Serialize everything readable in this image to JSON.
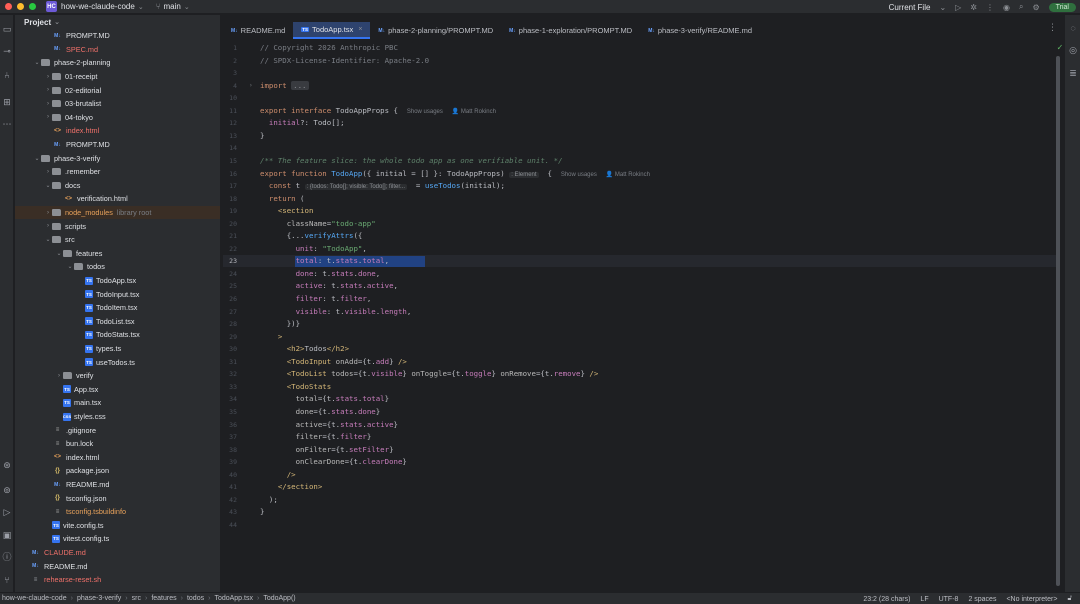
{
  "titlebar": {
    "badge": "HC",
    "project": "how-we-claude-code",
    "branch": "main",
    "run_config": "Current File",
    "trial": "Trial"
  },
  "project_panel": {
    "title": "Project",
    "rows": [
      {
        "name": "PROMPT.MD",
        "type": "md",
        "depth": 3,
        "arrow": ""
      },
      {
        "name": "SPEC.md",
        "type": "md",
        "depth": 3,
        "arrow": "",
        "color": "red"
      },
      {
        "name": "phase-2-planning",
        "type": "folder",
        "depth": 2,
        "arrow": "⌄"
      },
      {
        "name": "01-receipt",
        "type": "folder",
        "depth": 3,
        "arrow": "›"
      },
      {
        "name": "02-editorial",
        "type": "folder",
        "depth": 3,
        "arrow": "›"
      },
      {
        "name": "03-brutalist",
        "type": "folder",
        "depth": 3,
        "arrow": "›"
      },
      {
        "name": "04-tokyo",
        "type": "folder",
        "depth": 3,
        "arrow": "›"
      },
      {
        "name": "index.html",
        "type": "html",
        "depth": 3,
        "arrow": "",
        "color": "red"
      },
      {
        "name": "PROMPT.MD",
        "type": "md",
        "depth": 3,
        "arrow": ""
      },
      {
        "name": "phase-3-verify",
        "type": "folder",
        "depth": 2,
        "arrow": "⌄"
      },
      {
        "name": ".remember",
        "type": "folder",
        "depth": 3,
        "arrow": "›"
      },
      {
        "name": "docs",
        "type": "folder",
        "depth": 3,
        "arrow": "⌄"
      },
      {
        "name": "verification.html",
        "type": "html",
        "depth": 4,
        "arrow": ""
      },
      {
        "name": "node_modules",
        "type": "folder",
        "depth": 3,
        "arrow": "›",
        "color": "dim",
        "extra": "library root",
        "highlight": true
      },
      {
        "name": "scripts",
        "type": "folder",
        "depth": 3,
        "arrow": "›"
      },
      {
        "name": "src",
        "type": "folder",
        "depth": 3,
        "arrow": "⌄"
      },
      {
        "name": "features",
        "type": "folder",
        "depth": 4,
        "arrow": "⌄"
      },
      {
        "name": "todos",
        "type": "folder",
        "depth": 5,
        "arrow": "⌄"
      },
      {
        "name": "TodoApp.tsx",
        "type": "ts",
        "depth": 6,
        "arrow": ""
      },
      {
        "name": "TodoInput.tsx",
        "type": "ts",
        "depth": 6,
        "arrow": ""
      },
      {
        "name": "TodoItem.tsx",
        "type": "ts",
        "depth": 6,
        "arrow": ""
      },
      {
        "name": "TodoList.tsx",
        "type": "ts",
        "depth": 6,
        "arrow": ""
      },
      {
        "name": "TodoStats.tsx",
        "type": "ts",
        "depth": 6,
        "arrow": ""
      },
      {
        "name": "types.ts",
        "type": "ts",
        "depth": 6,
        "arrow": ""
      },
      {
        "name": "useTodos.ts",
        "type": "ts",
        "depth": 6,
        "arrow": ""
      },
      {
        "name": "verify",
        "type": "folder",
        "depth": 4,
        "arrow": "›"
      },
      {
        "name": "App.tsx",
        "type": "ts",
        "depth": 4,
        "arrow": ""
      },
      {
        "name": "main.tsx",
        "type": "ts",
        "depth": 4,
        "arrow": ""
      },
      {
        "name": "styles.css",
        "type": "css",
        "depth": 4,
        "arrow": ""
      },
      {
        "name": ".gitignore",
        "type": "txt",
        "depth": 3,
        "arrow": ""
      },
      {
        "name": "bun.lock",
        "type": "txt",
        "depth": 3,
        "arrow": ""
      },
      {
        "name": "index.html",
        "type": "html",
        "depth": 3,
        "arrow": ""
      },
      {
        "name": "package.json",
        "type": "json",
        "depth": 3,
        "arrow": ""
      },
      {
        "name": "README.md",
        "type": "md",
        "depth": 3,
        "arrow": ""
      },
      {
        "name": "tsconfig.json",
        "type": "json",
        "depth": 3,
        "arrow": ""
      },
      {
        "name": "tsconfig.tsbuildinfo",
        "type": "txt",
        "depth": 3,
        "arrow": "",
        "color": "dim"
      },
      {
        "name": "vite.config.ts",
        "type": "ts",
        "depth": 3,
        "arrow": ""
      },
      {
        "name": "vitest.config.ts",
        "type": "ts",
        "depth": 3,
        "arrow": ""
      },
      {
        "name": "CLAUDE.md",
        "type": "md",
        "depth": 1,
        "arrow": "",
        "color": "red"
      },
      {
        "name": "README.md",
        "type": "md",
        "depth": 1,
        "arrow": ""
      },
      {
        "name": "rehearse-reset.sh",
        "type": "sh",
        "depth": 1,
        "arrow": "",
        "color": "red"
      }
    ]
  },
  "tabs": [
    {
      "label": "README.md",
      "icon": "M↓",
      "kind": "md",
      "active": false
    },
    {
      "label": "TodoApp.tsx",
      "icon": "TS",
      "kind": "ts",
      "active": true
    },
    {
      "label": "phase-2-planning/PROMPT.MD",
      "icon": "M↓",
      "kind": "md",
      "active": false
    },
    {
      "label": "phase-1-exploration/PROMPT.MD",
      "icon": "M↓",
      "kind": "md",
      "active": false
    },
    {
      "label": "phase-3-verify/README.md",
      "icon": "M↓",
      "kind": "md",
      "active": false
    }
  ],
  "editor": {
    "current_line": 23,
    "lines": [
      {
        "n": "1",
        "html": "<span class='c'>// Copyright 2026 Anthropic PBC</span>"
      },
      {
        "n": "2",
        "html": "<span class='c'>// SPDX-License-Identifier: Apache-2.0</span>"
      },
      {
        "n": "3",
        "html": ""
      },
      {
        "n": "4",
        "html": "<span class='k'>import</span> <span class='folded'>...</span>",
        "fold": "›"
      },
      {
        "n": "10",
        "html": ""
      },
      {
        "n": "11",
        "html": "<span class='k'>export interface</span> TodoAppProps {  <span class='hint'>Show usages</span>  <span class='hint'>👤 Matt Rokinch</span>"
      },
      {
        "n": "12",
        "html": "  <span class='p'>initial</span>?: Todo[];"
      },
      {
        "n": "13",
        "html": "}"
      },
      {
        "n": "14",
        "html": ""
      },
      {
        "n": "15",
        "html": "<span class='ci'>/** The feature slice: the whole todo app as one verifiable unit. */</span>"
      },
      {
        "n": "16",
        "html": "<span class='k'>export function</span> <span class='f'>TodoApp</span>({ initial = [] }: TodoAppProps) <span class='inlay'>: Element</span>  {  <span class='hint'>Show usages</span>  <span class='hint'>👤 Matt Rokinch</span>"
      },
      {
        "n": "17",
        "html": "  <span class='k'>const</span> t <span class='inlay'>: {todos: Todo[]; visible: Todo[]; filter...</span>  = <span class='f'>useTodos</span>(initial);"
      },
      {
        "n": "18",
        "html": "  <span class='k'>return</span> ("
      },
      {
        "n": "19",
        "html": "    <span class='tg'>&lt;section</span>"
      },
      {
        "n": "20",
        "html": "      <span class='at'>className</span>=<span class='s'>\"todo-app\"</span>"
      },
      {
        "n": "21",
        "html": "      {...<span class='f'>verifyAttrs</span>({"
      },
      {
        "n": "22",
        "html": "        <span class='p'>unit</span>: <span class='s'>\"TodoApp\"</span>,"
      },
      {
        "n": "23",
        "html": "        <span class='p'>total</span>: t.<span class='p'>stats</span>.<span class='p'>total</span>,",
        "selected": true
      },
      {
        "n": "24",
        "html": "        <span class='p'>done</span>: t.<span class='p'>stats</span>.<span class='p'>done</span>,"
      },
      {
        "n": "25",
        "html": "        <span class='p'>active</span>: t.<span class='p'>stats</span>.<span class='p'>active</span>,"
      },
      {
        "n": "26",
        "html": "        <span class='p'>filter</span>: t.<span class='p'>filter</span>,"
      },
      {
        "n": "27",
        "html": "        <span class='p'>visible</span>: t.<span class='p'>visible</span>.<span class='p'>length</span>,"
      },
      {
        "n": "28",
        "html": "      })}"
      },
      {
        "n": "29",
        "html": "    <span class='tg'>&gt;</span>"
      },
      {
        "n": "30",
        "html": "      <span class='tg'>&lt;h2&gt;</span>Todos<span class='tg'>&lt;/h2&gt;</span>"
      },
      {
        "n": "31",
        "html": "      <span class='tg'>&lt;TodoInput</span> <span class='at'>onAdd</span>={t.<span class='p'>add</span>} <span class='tg'>/&gt;</span>"
      },
      {
        "n": "32",
        "html": "      <span class='tg'>&lt;TodoList</span> <span class='at'>todos</span>={t.<span class='p'>visible</span>} <span class='at'>onToggle</span>={t.<span class='p'>toggle</span>} <span class='at'>onRemove</span>={t.<span class='p'>remove</span>} <span class='tg'>/&gt;</span>"
      },
      {
        "n": "33",
        "html": "      <span class='tg'>&lt;TodoStats</span>"
      },
      {
        "n": "34",
        "html": "        <span class='at'>total</span>={t.<span class='p'>stats</span>.<span class='p'>total</span>}"
      },
      {
        "n": "35",
        "html": "        <span class='at'>done</span>={t.<span class='p'>stats</span>.<span class='p'>done</span>}"
      },
      {
        "n": "36",
        "html": "        <span class='at'>active</span>={t.<span class='p'>stats</span>.<span class='p'>active</span>}"
      },
      {
        "n": "37",
        "html": "        <span class='at'>filter</span>={t.<span class='p'>filter</span>}"
      },
      {
        "n": "38",
        "html": "        <span class='at'>onFilter</span>={t.<span class='p'>setFilter</span>}"
      },
      {
        "n": "39",
        "html": "        <span class='at'>onClearDone</span>={t.<span class='p'>clearDone</span>}"
      },
      {
        "n": "40",
        "html": "      <span class='tg'>/&gt;</span>"
      },
      {
        "n": "41",
        "html": "    <span class='tg'>&lt;/section&gt;</span>"
      },
      {
        "n": "42",
        "html": "  );"
      },
      {
        "n": "43",
        "html": "}"
      },
      {
        "n": "44",
        "html": ""
      }
    ]
  },
  "statusbar": {
    "breadcrumb": [
      "how-we-claude-code",
      "phase-3-verify",
      "src",
      "features",
      "todos",
      "TodoApp.tsx",
      "TodoApp()"
    ],
    "position": "23:2 (28 chars)",
    "line_sep": "LF",
    "encoding": "UTF-8",
    "indent": "2 spaces",
    "interpreter": "<No interpreter>"
  }
}
